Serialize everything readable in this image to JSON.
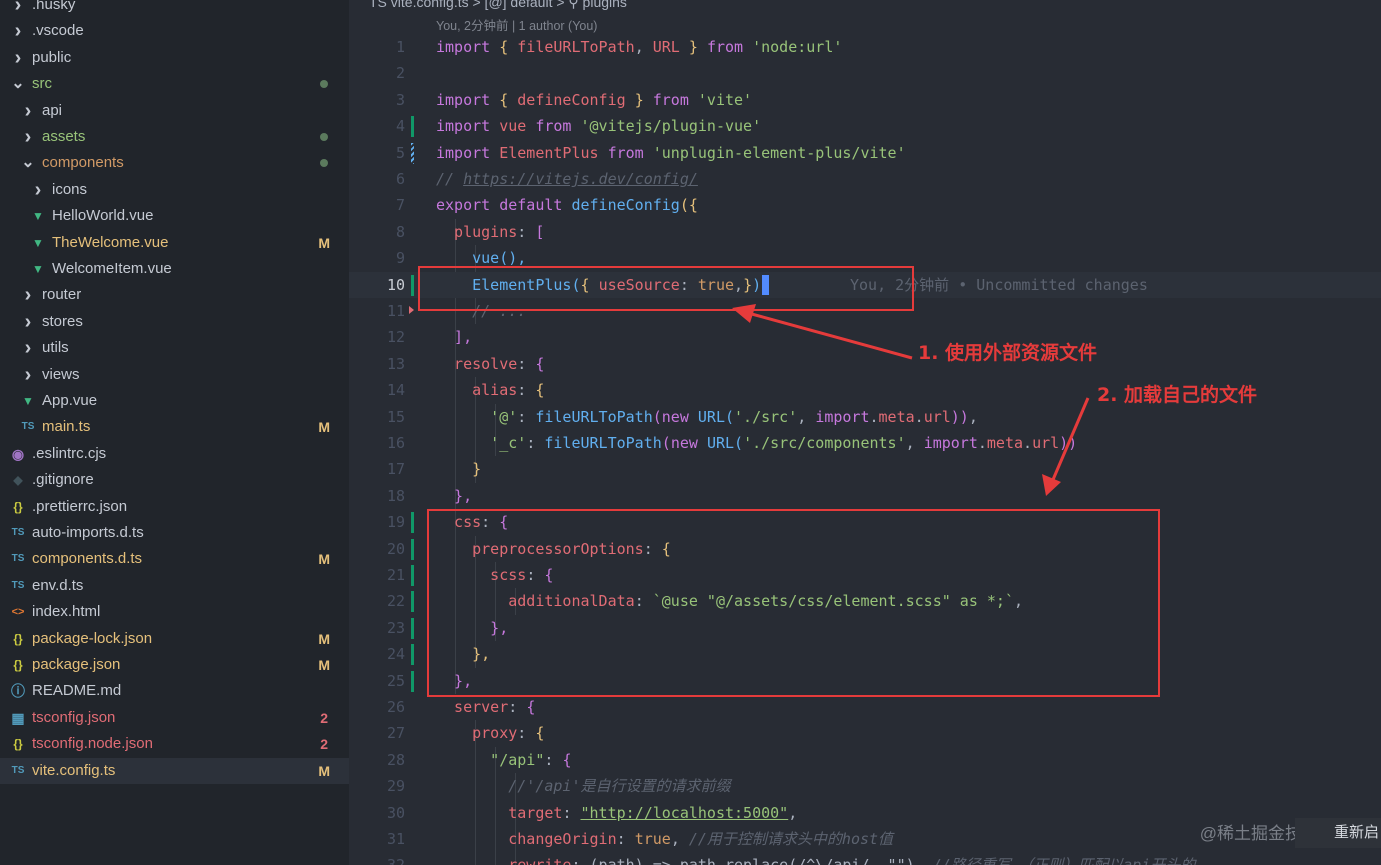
{
  "colors": {
    "keyword": "#c678dd",
    "function": "#61afef",
    "string": "#98c379",
    "property": "#e06c75",
    "constant": "#d19a66",
    "comment": "#5c6370",
    "plain": "#abb2bf",
    "brace1": "#e5c07b",
    "brace2": "#c678dd",
    "brace3": "#61afef",
    "modified": "#d19a66",
    "error": "#e06c75",
    "annotation": "#e53b3b"
  },
  "explorer": {
    "items": [
      {
        "label": ".husky",
        "icon": "chevron-right",
        "indent": 0
      },
      {
        "label": ".vscode",
        "icon": "chevron-right",
        "indent": 0
      },
      {
        "label": "public",
        "icon": "chevron-right",
        "indent": 0
      },
      {
        "label": "src",
        "icon": "chevron-down",
        "indent": 0,
        "color": "#98c379",
        "dot": true
      },
      {
        "label": "api",
        "icon": "chevron-right",
        "indent": 1
      },
      {
        "label": "assets",
        "icon": "chevron-right",
        "indent": 1,
        "color": "#98c379",
        "dot": true
      },
      {
        "label": "components",
        "icon": "chevron-down",
        "indent": 1,
        "color": "#d19a66",
        "dot": true
      },
      {
        "label": "icons",
        "icon": "chevron-right",
        "indent": 2
      },
      {
        "label": "HelloWorld.vue",
        "icon": "vue",
        "indent": 2
      },
      {
        "label": "TheWelcome.vue",
        "icon": "vue",
        "indent": 2,
        "color": "#e5c07b",
        "badge": "M"
      },
      {
        "label": "WelcomeItem.vue",
        "icon": "vue",
        "indent": 2
      },
      {
        "label": "router",
        "icon": "chevron-right",
        "indent": 1
      },
      {
        "label": "stores",
        "icon": "chevron-right",
        "indent": 1
      },
      {
        "label": "utils",
        "icon": "chevron-right",
        "indent": 1
      },
      {
        "label": "views",
        "icon": "chevron-right",
        "indent": 1
      },
      {
        "label": "App.vue",
        "icon": "vue",
        "indent": 1
      },
      {
        "label": "main.ts",
        "icon": "ts",
        "indent": 1,
        "color": "#e5c07b",
        "badge": "M"
      },
      {
        "label": ".eslintrc.cjs",
        "icon": "eslint",
        "indent": 0
      },
      {
        "label": ".gitignore",
        "icon": "git",
        "indent": 0
      },
      {
        "label": ".prettierrc.json",
        "icon": "json",
        "indent": 0
      },
      {
        "label": "auto-imports.d.ts",
        "icon": "ts",
        "indent": 0
      },
      {
        "label": "components.d.ts",
        "icon": "ts",
        "indent": 0,
        "color": "#e5c07b",
        "badge": "M"
      },
      {
        "label": "env.d.ts",
        "icon": "ts",
        "indent": 0
      },
      {
        "label": "index.html",
        "icon": "html",
        "indent": 0
      },
      {
        "label": "package-lock.json",
        "icon": "json",
        "indent": 0,
        "color": "#e5c07b",
        "badge": "M"
      },
      {
        "label": "package.json",
        "icon": "json",
        "indent": 0,
        "color": "#e5c07b",
        "badge": "M"
      },
      {
        "label": "README.md",
        "icon": "info",
        "indent": 0
      },
      {
        "label": "tsconfig.json",
        "icon": "tsconfig",
        "indent": 0,
        "color": "#e06c75",
        "badge": "2"
      },
      {
        "label": "tsconfig.node.json",
        "icon": "json",
        "indent": 0,
        "color": "#e06c75",
        "badge": "2"
      },
      {
        "label": "vite.config.ts",
        "icon": "ts",
        "indent": 0,
        "color": "#e5c07b",
        "badge": "M",
        "active": true
      }
    ]
  },
  "editor": {
    "breadcrumb": "TS vite.config.ts > [@] default > ⚲ plugins",
    "blame_header": "You, 2分钟前 | 1 author (You)",
    "current_line": 10,
    "inline_blame": "You, 2分钟前 • Uncommitted changes",
    "lines": [
      {
        "n": 1,
        "tokens": [
          [
            "import ",
            "keyword"
          ],
          [
            "{ ",
            "brace1"
          ],
          [
            "fileURLToPath",
            "property"
          ],
          [
            ", ",
            "plain"
          ],
          [
            "URL ",
            "property"
          ],
          [
            "} ",
            "brace1"
          ],
          [
            "from ",
            "keyword"
          ],
          [
            "'node:url'",
            "string"
          ]
        ]
      },
      {
        "n": 2,
        "tokens": []
      },
      {
        "n": 3,
        "tokens": [
          [
            "import ",
            "keyword"
          ],
          [
            "{ ",
            "brace1"
          ],
          [
            "defineConfig ",
            "property"
          ],
          [
            "} ",
            "brace1"
          ],
          [
            "from ",
            "keyword"
          ],
          [
            "'vite'",
            "string"
          ]
        ]
      },
      {
        "n": 4,
        "tokens": [
          [
            "import ",
            "keyword"
          ],
          [
            "vue ",
            "property"
          ],
          [
            "from ",
            "keyword"
          ],
          [
            "'@vitejs/plugin-vue'",
            "string"
          ]
        ],
        "mark": "modified"
      },
      {
        "n": 5,
        "tokens": [
          [
            "import ",
            "keyword"
          ],
          [
            "ElementPlus ",
            "property"
          ],
          [
            "from ",
            "keyword"
          ],
          [
            "'unplugin-element-plus/vite'",
            "string"
          ]
        ],
        "mark": "hatch"
      },
      {
        "n": 6,
        "tokens": [
          [
            "// ",
            "comment"
          ],
          [
            "https://vitejs.dev/config/",
            "comment"
          ]
        ]
      },
      {
        "n": 7,
        "tokens": [
          [
            "export ",
            "keyword"
          ],
          [
            "default ",
            "keyword"
          ],
          [
            "defineConfig",
            "function"
          ],
          [
            "({",
            "brace1"
          ]
        ]
      },
      {
        "n": 8,
        "tokens": [
          [
            "  plugins",
            "property"
          ],
          [
            ": ",
            "plain"
          ],
          [
            "[",
            "brace2"
          ]
        ]
      },
      {
        "n": 9,
        "tokens": [
          [
            "    vue",
            "function"
          ],
          [
            "(),",
            "brace3"
          ]
        ]
      },
      {
        "n": 10,
        "tokens": [
          [
            "    ElementPlus",
            "function"
          ],
          [
            "(",
            "brace3"
          ],
          [
            "{ ",
            "brace1"
          ],
          [
            "useSource",
            "property"
          ],
          [
            ": ",
            "plain"
          ],
          [
            "true",
            "constant"
          ],
          [
            ",",
            "plain"
          ],
          [
            "}",
            "brace1"
          ],
          [
            ")",
            "brace3"
          ]
        ],
        "mark": "modified"
      },
      {
        "n": 11,
        "tokens": [
          [
            "    // ...",
            "comment"
          ]
        ],
        "mark": "deleted"
      },
      {
        "n": 12,
        "tokens": [
          [
            "  ],",
            "brace2"
          ]
        ]
      },
      {
        "n": 13,
        "tokens": [
          [
            "  resolve",
            "property"
          ],
          [
            ": ",
            "plain"
          ],
          [
            "{",
            "brace2"
          ]
        ]
      },
      {
        "n": 14,
        "tokens": [
          [
            "    alias",
            "property"
          ],
          [
            ": ",
            "plain"
          ],
          [
            "{",
            "brace1"
          ]
        ]
      },
      {
        "n": 15,
        "tokens": [
          [
            "      '@'",
            "string"
          ],
          [
            ": ",
            "plain"
          ],
          [
            "fileURLToPath",
            "function"
          ],
          [
            "(",
            "brace2"
          ],
          [
            "new ",
            "keyword"
          ],
          [
            "URL",
            "function"
          ],
          [
            "(",
            "brace3"
          ],
          [
            "'./src'",
            "string"
          ],
          [
            ", ",
            "plain"
          ],
          [
            "import",
            "keyword"
          ],
          [
            ".",
            "plain"
          ],
          [
            "meta",
            "property"
          ],
          [
            ".",
            "plain"
          ],
          [
            "url",
            "property"
          ],
          [
            "))",
            "brace2"
          ],
          [
            ",",
            "plain"
          ]
        ]
      },
      {
        "n": 16,
        "tokens": [
          [
            "      '_c'",
            "string"
          ],
          [
            ": ",
            "plain"
          ],
          [
            "fileURLToPath",
            "function"
          ],
          [
            "(",
            "brace2"
          ],
          [
            "new ",
            "keyword"
          ],
          [
            "URL",
            "function"
          ],
          [
            "(",
            "brace3"
          ],
          [
            "'./src/components'",
            "string"
          ],
          [
            ", ",
            "plain"
          ],
          [
            "import",
            "keyword"
          ],
          [
            ".",
            "plain"
          ],
          [
            "meta",
            "property"
          ],
          [
            ".",
            "plain"
          ],
          [
            "url",
            "property"
          ],
          [
            "))",
            "brace2"
          ]
        ]
      },
      {
        "n": 17,
        "tokens": [
          [
            "    }",
            "brace1"
          ]
        ]
      },
      {
        "n": 18,
        "tokens": [
          [
            "  },",
            "brace2"
          ]
        ]
      },
      {
        "n": 19,
        "tokens": [
          [
            "  css",
            "property"
          ],
          [
            ": ",
            "plain"
          ],
          [
            "{",
            "brace2"
          ]
        ],
        "mark": "modified"
      },
      {
        "n": 20,
        "tokens": [
          [
            "    preprocessorOptions",
            "property"
          ],
          [
            ": ",
            "plain"
          ],
          [
            "{",
            "brace1"
          ]
        ],
        "mark": "modified"
      },
      {
        "n": 21,
        "tokens": [
          [
            "      scss",
            "property"
          ],
          [
            ": ",
            "plain"
          ],
          [
            "{",
            "brace2"
          ]
        ],
        "mark": "modified"
      },
      {
        "n": 22,
        "tokens": [
          [
            "        additionalData",
            "property"
          ],
          [
            ": ",
            "plain"
          ],
          [
            "`@use \"@/assets/css/element.scss\" as *;`",
            "string"
          ],
          [
            ",",
            "plain"
          ]
        ],
        "mark": "modified"
      },
      {
        "n": 23,
        "tokens": [
          [
            "      },",
            "brace2"
          ]
        ],
        "mark": "modified"
      },
      {
        "n": 24,
        "tokens": [
          [
            "    },",
            "brace1"
          ]
        ],
        "mark": "modified"
      },
      {
        "n": 25,
        "tokens": [
          [
            "  },",
            "brace2"
          ]
        ],
        "mark": "modified"
      },
      {
        "n": 26,
        "tokens": [
          [
            "  server",
            "property"
          ],
          [
            ": ",
            "plain"
          ],
          [
            "{",
            "brace2"
          ]
        ]
      },
      {
        "n": 27,
        "tokens": [
          [
            "    proxy",
            "property"
          ],
          [
            ": ",
            "plain"
          ],
          [
            "{",
            "brace1"
          ]
        ]
      },
      {
        "n": 28,
        "tokens": [
          [
            "      \"/api\"",
            "string"
          ],
          [
            ": ",
            "plain"
          ],
          [
            "{",
            "brace2"
          ]
        ]
      },
      {
        "n": 29,
        "tokens": [
          [
            "        //'/api'是自行设置的请求前缀",
            "comment"
          ]
        ]
      },
      {
        "n": 30,
        "tokens": [
          [
            "        target",
            "property"
          ],
          [
            ": ",
            "plain"
          ],
          [
            "\"http://localhost:5000\"",
            "string"
          ],
          [
            ",",
            "plain"
          ]
        ]
      },
      {
        "n": 31,
        "tokens": [
          [
            "        changeOrigin",
            "property"
          ],
          [
            ": ",
            "plain"
          ],
          [
            "true",
            "constant"
          ],
          [
            ", ",
            "plain"
          ],
          [
            "//用于控制请求头中的host值",
            "comment"
          ]
        ]
      },
      {
        "n": 32,
        "tokens": [
          [
            "        rewrite",
            "property"
          ],
          [
            ": ",
            "plain"
          ],
          [
            "(path) => path.replace(/^\\/api/, \"\"),",
            "plain"
          ],
          [
            " //路径重写，（正则）匹配以api开头的",
            "comment"
          ]
        ]
      }
    ]
  },
  "annotations": {
    "label1": "1. 使用外部资源文件",
    "label2": "2. 加载自己的文件"
  },
  "watermark": "@稀土掘金技术社区",
  "toast": "重新启"
}
